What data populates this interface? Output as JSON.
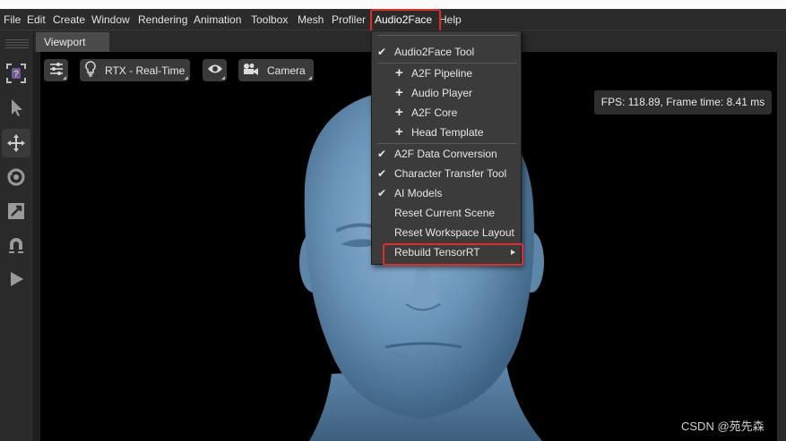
{
  "menubar": {
    "items": [
      "File",
      "Edit",
      "Create",
      "Window",
      "Rendering",
      "Animation",
      "Toolbox",
      "Mesh",
      "Profiler",
      "Audio2Face",
      "Help"
    ]
  },
  "tabs": {
    "viewport": "Viewport"
  },
  "viewport_toolbar": {
    "settings_icon": "sliders-icon",
    "renderer_label": "RTX - Real-Time",
    "renderer_icon": "lightbulb-icon",
    "visibility_icon": "eye-icon",
    "camera_label": "Camera",
    "camera_icon": "movie-camera-icon"
  },
  "stats": {
    "fps_text": "FPS: 118.89, Frame time: 8.41 ms"
  },
  "left_tools": [
    "help-select-icon",
    "pointer-icon",
    "move-icon",
    "rotate-icon",
    "scale-icon",
    "snap-magnet-icon",
    "play-icon"
  ],
  "dropdown": {
    "items": [
      {
        "label": "Audio2Face Tool",
        "mark": "check"
      },
      {
        "label": "A2F Pipeline",
        "mark": "plus"
      },
      {
        "label": "Audio Player",
        "mark": "plus"
      },
      {
        "label": "A2F Core",
        "mark": "plus"
      },
      {
        "label": "Head Template",
        "mark": "plus"
      },
      {
        "label": "A2F Data Conversion",
        "mark": "check"
      },
      {
        "label": "Character Transfer Tool",
        "mark": "check"
      },
      {
        "label": "AI Models",
        "mark": "check"
      },
      {
        "label": "Reset Current Scene",
        "mark": ""
      },
      {
        "label": "Reset Workspace Layout",
        "mark": ""
      },
      {
        "label": "Rebuild TensorRT",
        "mark": "submenu"
      }
    ]
  },
  "watermark": "CSDN @苑先森",
  "colors": {
    "highlight": "#e52a2a",
    "head_skin": "#6f9cc0",
    "menu_bg": "#3b3b3b"
  }
}
